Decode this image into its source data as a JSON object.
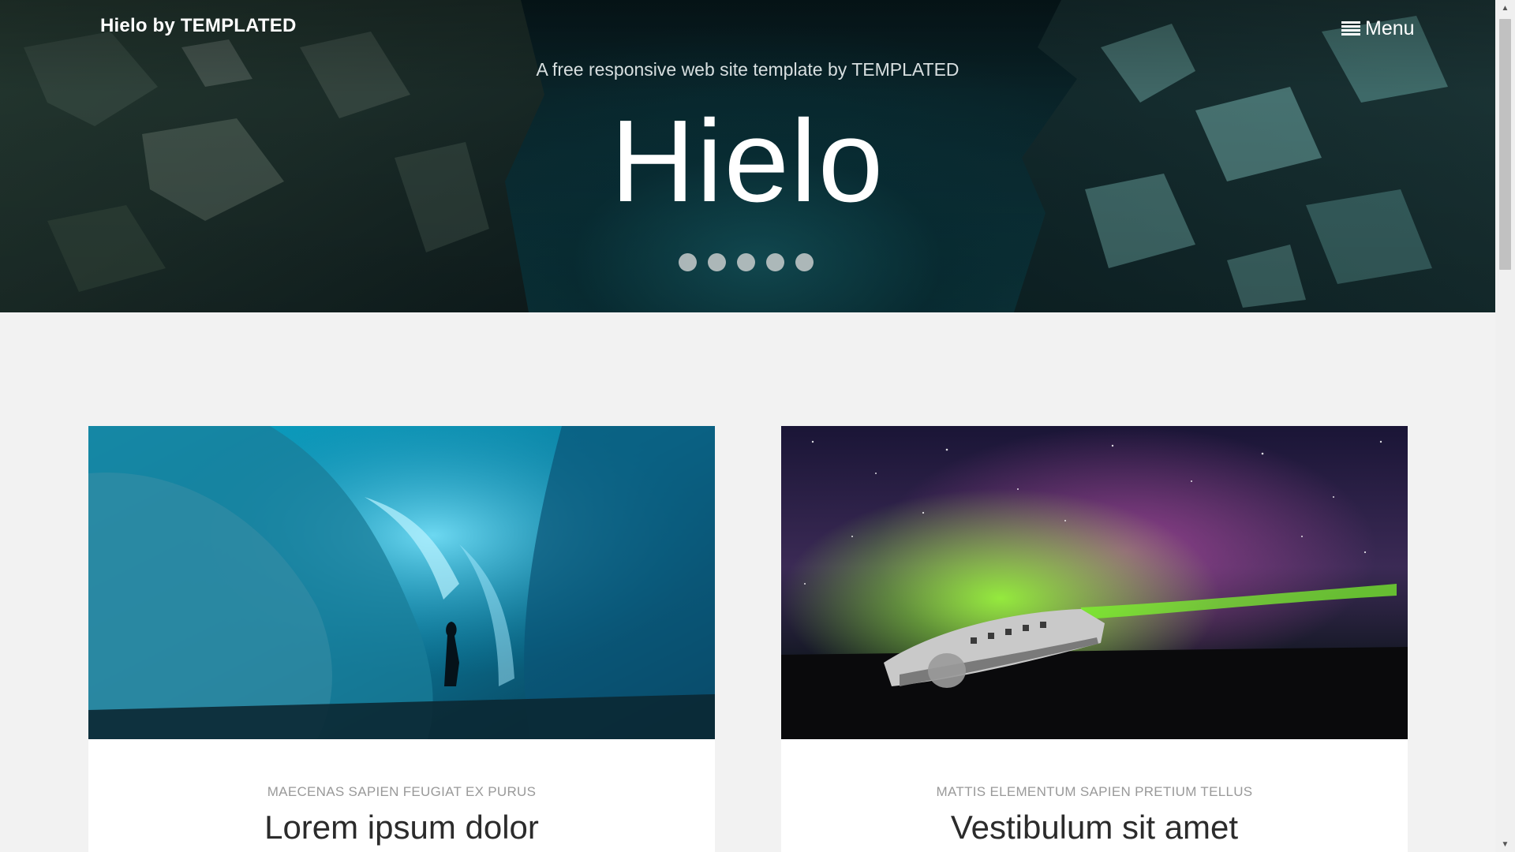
{
  "header": {
    "logo": "Hielo by TEMPLATED",
    "menu_label": "Menu",
    "menu_icon": "hamburger-icon"
  },
  "banner": {
    "tagline": "A free responsive web site template by TEMPLATED",
    "title": "Hielo",
    "slides_count": 5,
    "colors": {
      "sky": "#0b2b31",
      "rock": "#1a3a38",
      "ice": "#6fb7b3"
    }
  },
  "cards": [
    {
      "category": "MAECENAS SAPIEN FEUGIAT EX PURUS",
      "title": "Lorem ipsum dolor",
      "image": "ice-cave-photo"
    },
    {
      "category": "MATTIS ELEMENTUM SAPIEN PRETIUM TELLUS",
      "title": "Vestibulum sit amet",
      "image": "aurora-plane-wreck-photo"
    }
  ]
}
